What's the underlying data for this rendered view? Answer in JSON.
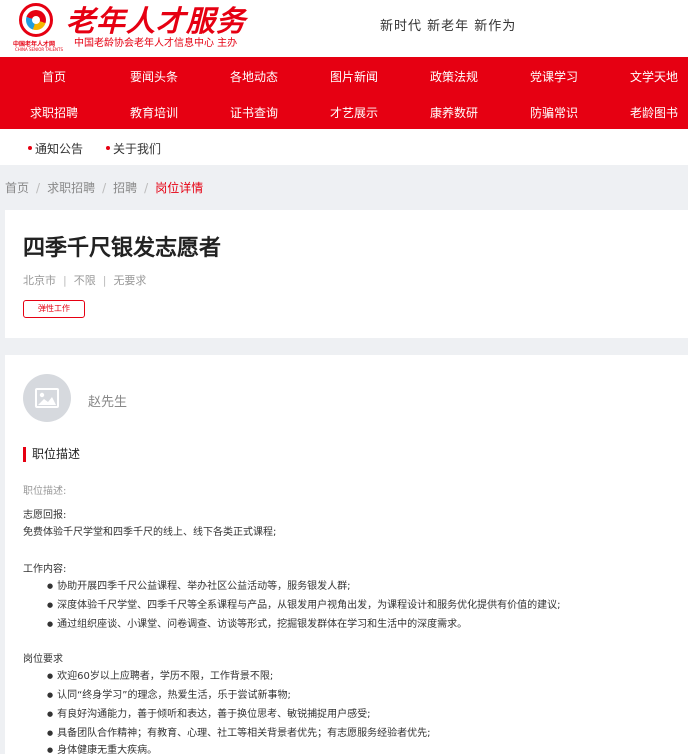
{
  "header": {
    "site_title": "老年人才服务",
    "site_subtitle": "中国老龄协会老年人才信息中心 主办",
    "logo_org": "中国老年人才网",
    "logo_en": "CHINA SENIOR TALENTS",
    "slogan": "新时代 新老年 新作为"
  },
  "nav": {
    "row1": [
      "首页",
      "要闻头条",
      "各地动态",
      "图片新闻",
      "政策法规",
      "党课学习",
      "文学天地"
    ],
    "row2": [
      "求职招聘",
      "教育培训",
      "证书查询",
      "才艺展示",
      "康养数研",
      "防骗常识",
      "老龄图书"
    ]
  },
  "subnav": {
    "items": [
      "通知公告",
      "关于我们"
    ]
  },
  "breadcrumb": {
    "home": "首页",
    "level2": "求职招聘",
    "level3": "招聘",
    "current": "岗位详情"
  },
  "job": {
    "title": "四季千尺银发志愿者",
    "city": "北京市",
    "education": "不限",
    "experience": "无要求",
    "tag": "弹性工作"
  },
  "contact": {
    "name": "赵先生"
  },
  "description": {
    "section_title": "职位描述",
    "label": "职位描述:",
    "reward_title": "志愿回报:",
    "reward_text": "免费体验千尺学堂和四季千尺的线上、线下各类正式课程;",
    "work_title": "工作内容:",
    "work_items": [
      "协助开展四季千尺公益课程、举办社区公益活动等，服务银发人群;",
      "深度体验千尺学堂、四季千尺等全系课程与产品，从银发用户视角出发，为课程设计和服务优化提供有价值的建议;",
      "通过组织座谈、小课堂、问卷调查、访谈等形式，挖掘银发群体在学习和生活中的深度需求。"
    ],
    "req_title": "岗位要求",
    "req_items": [
      "欢迎60岁以上应聘者，学历不限，工作背景不限;",
      "认同“终身学习”的理念，热爱生活，乐于尝试新事物;",
      "有良好沟通能力，善于倾听和表达，善于换位思考、敏锐捕捉用户感受;",
      "具备团队合作精神；有教育、心理、社工等相关背景者优先；有志愿服务经验者优先;",
      "身体健康无重大疾病。"
    ]
  },
  "colors": {
    "brand_red": "#e60012",
    "page_bg": "#eef0f3"
  }
}
